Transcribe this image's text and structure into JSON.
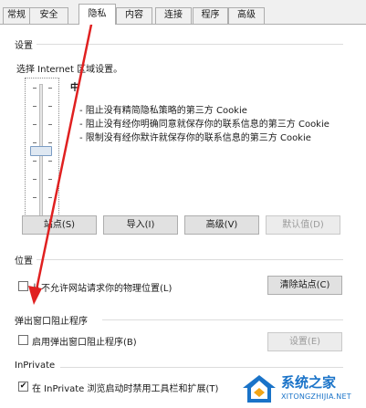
{
  "tabs": [
    {
      "label": "常规"
    },
    {
      "label": "安全"
    },
    {
      "label": "隐私"
    },
    {
      "label": "内容"
    },
    {
      "label": "连接"
    },
    {
      "label": "程序"
    },
    {
      "label": "高级"
    }
  ],
  "active_tab": "隐私",
  "settings": {
    "group_title": "设置",
    "instruction": "选择 Internet 区域设置。",
    "slider_level": 0.5,
    "level_label": "中",
    "descriptions": [
      "- 阻止没有精简隐私策略的第三方 Cookie",
      "- 阻止没有经你明确同意就保存你的联系信息的第三方 Cookie",
      "- 限制没有经你默许就保存你的联系信息的第三方 Cookie"
    ],
    "buttons": {
      "sites": "站点(S)",
      "import": "导入(I)",
      "advanced": "高级(V)",
      "default": "默认值(D)"
    }
  },
  "location": {
    "group_title": "位置",
    "checkbox_label": "从不允许网站请求你的物理位置(L)",
    "checked": false,
    "clear_button": "清除站点(C)"
  },
  "popup": {
    "group_title": "弹出窗口阻止程序",
    "checkbox_label": "启用弹出窗口阻止程序(B)",
    "checked": false,
    "settings_button": "设置(E)"
  },
  "inprivate": {
    "group_title": "InPrivate",
    "checkbox_label": "在 InPrivate 浏览启动时禁用工具栏和扩展(T)",
    "checked": true,
    "check_mark": "✔"
  },
  "watermark": {
    "title": "系统之家",
    "url": "XITONGZHIJIA.NET"
  },
  "colors": {
    "annotation_arrow": "#e02020",
    "watermark_blue": "#1a73c8"
  }
}
